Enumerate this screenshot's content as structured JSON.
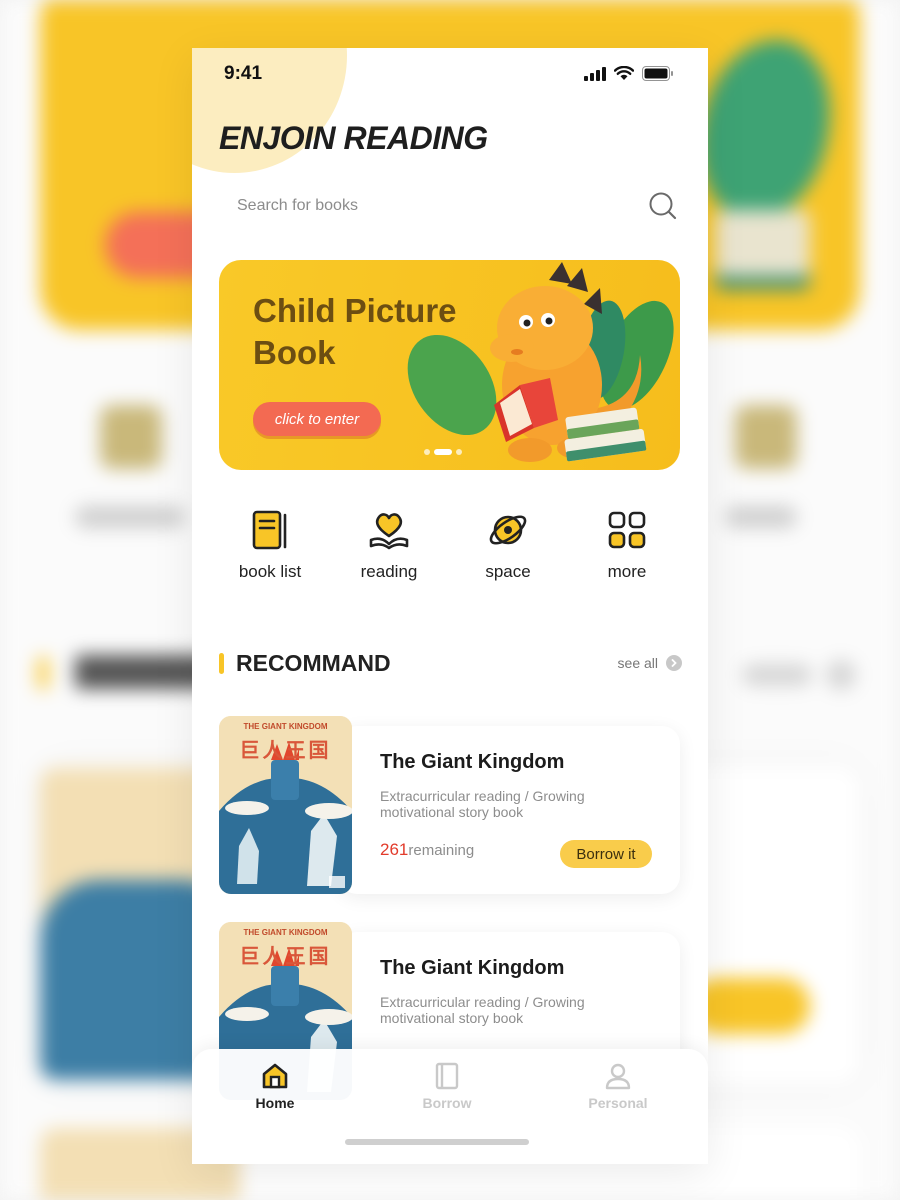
{
  "status": {
    "time": "9:41"
  },
  "app": {
    "title": "ENJOIN READING"
  },
  "search": {
    "placeholder": "Search for books",
    "icon": "search-icon"
  },
  "banner": {
    "title": "Child Picture Book",
    "button_label": "click to enter",
    "dots": 3,
    "active_dot": 1
  },
  "quick_nav": [
    {
      "label": "book list",
      "icon": "book-list-icon"
    },
    {
      "label": "reading",
      "icon": "heart-book-icon"
    },
    {
      "label": "space",
      "icon": "planet-icon"
    },
    {
      "label": "more",
      "icon": "grid-icon"
    }
  ],
  "section": {
    "title": "RECOMMAND",
    "see_all": "see all"
  },
  "books": [
    {
      "title": "The Giant Kingdom",
      "description": "Extracurricular reading / Growing motivational story book",
      "remaining_count": "261",
      "remaining_label": "remaining",
      "button_label": "Borrow it",
      "cover_tag": "THE GIANT KINGDOM",
      "cover_title": "巨人王国"
    },
    {
      "title": "The Giant Kingdom",
      "description": "Extracurricular reading / Growing motivational story book",
      "cover_tag": "THE GIANT KINGDOM",
      "cover_title": "巨人王国"
    }
  ],
  "tabs": [
    {
      "label": "Home",
      "icon": "home-icon",
      "active": true
    },
    {
      "label": "Borrow",
      "icon": "book-icon",
      "active": false
    },
    {
      "label": "Personal",
      "icon": "person-icon",
      "active": false
    }
  ],
  "colors": {
    "accent": "#f8c527",
    "button_red": "#f36a52",
    "badge_red": "#e23b2b",
    "text_dark": "#1c1c1c"
  }
}
